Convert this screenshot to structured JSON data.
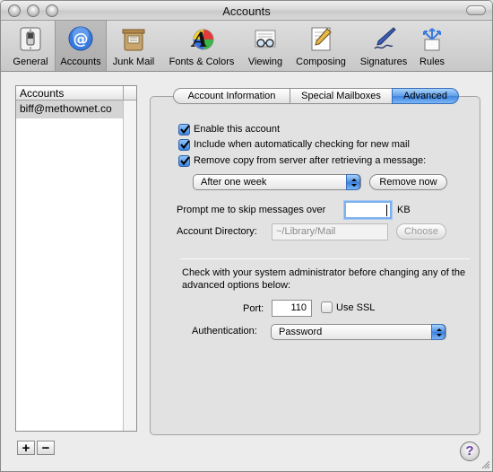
{
  "window": {
    "title": "Accounts"
  },
  "toolbar": {
    "items": [
      {
        "label": "General",
        "icon": "light-switch-icon"
      },
      {
        "label": "Accounts",
        "icon": "at-sign-icon"
      },
      {
        "label": "Junk Mail",
        "icon": "junk-mail-bin-icon"
      },
      {
        "label": "Fonts & Colors",
        "icon": "color-font-icon"
      },
      {
        "label": "Viewing",
        "icon": "eyeglasses-icon"
      },
      {
        "label": "Composing",
        "icon": "pencil-paper-icon"
      },
      {
        "label": "Signatures",
        "icon": "fountain-pen-icon"
      },
      {
        "label": "Rules",
        "icon": "rules-arrows-icon"
      }
    ],
    "selected": "Accounts"
  },
  "accounts": {
    "header": "Accounts",
    "items": [
      "biff@methownet.co"
    ],
    "add_label": "+",
    "remove_label": "−"
  },
  "tabs": {
    "items": [
      "Account Information",
      "Special Mailboxes",
      "Advanced"
    ],
    "active": "Advanced"
  },
  "advanced": {
    "enable_account": {
      "label": "Enable this account",
      "checked": true
    },
    "include_checking": {
      "label": "Include when automatically checking for new mail",
      "checked": true
    },
    "remove_copy": {
      "label": "Remove copy from server after retrieving a message:",
      "checked": true
    },
    "remove_after": {
      "value": "After one week"
    },
    "remove_now_label": "Remove now",
    "skip_prompt_label": "Prompt me to skip messages over",
    "skip_value": "",
    "skip_unit": "KB",
    "account_dir_label": "Account Directory:",
    "account_dir_value": "~/Library/Mail",
    "choose_label": "Choose",
    "admin_note": "Check with your system administrator before changing any of the advanced options below:",
    "port_label": "Port:",
    "port_value": "110",
    "use_ssl": {
      "label": "Use SSL",
      "checked": false
    },
    "auth_label": "Authentication:",
    "auth_value": "Password"
  },
  "help_label": "?"
}
